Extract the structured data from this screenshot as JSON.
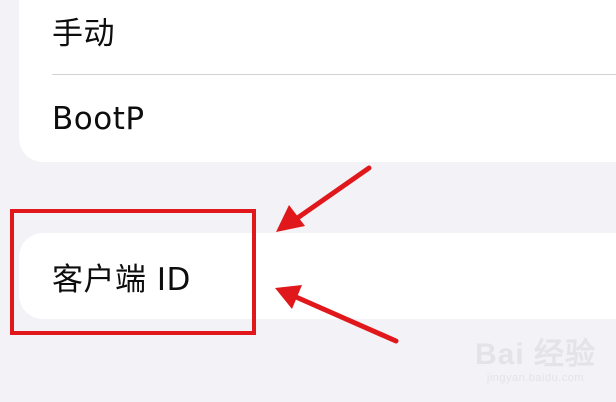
{
  "ip_config_options": {
    "items": [
      {
        "label": "手动"
      },
      {
        "label": "BootP"
      }
    ]
  },
  "client_id": {
    "label": "客户端 ID"
  },
  "annotation": {
    "color": "#e0181b"
  },
  "watermark": {
    "text": "Bai 经验",
    "subtext": "jingyan.baidu.com"
  }
}
